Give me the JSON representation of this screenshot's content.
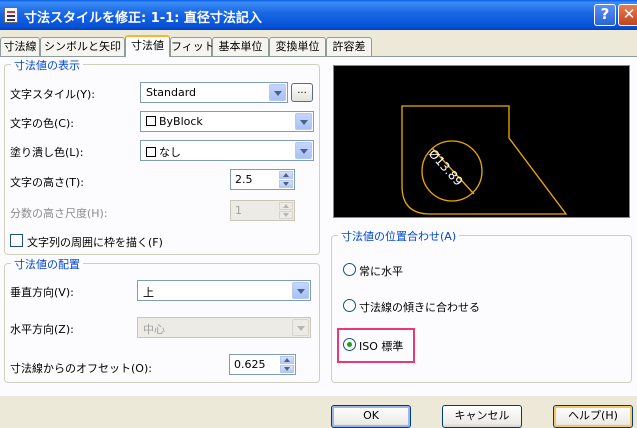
{
  "window": {
    "title": "寸法スタイルを修正: 1-1: 直径寸法記入",
    "help_glyph": "?",
    "close_glyph": "✕"
  },
  "tabs": [
    {
      "label": "寸法線"
    },
    {
      "label": "シンボルと矢印"
    },
    {
      "label": "寸法値",
      "active": true
    },
    {
      "label": "フィット"
    },
    {
      "label": "基本単位"
    },
    {
      "label": "変換単位"
    },
    {
      "label": "許容差"
    }
  ],
  "text_appearance": {
    "group_title": "寸法値の表示",
    "text_style_label": "文字スタイル(Y):",
    "text_style_value": "Standard",
    "ellipsis_label": "...",
    "text_color_label": "文字の色(C):",
    "text_color_value": "ByBlock",
    "fill_color_label": "塗り潰し色(L):",
    "fill_color_value": "なし",
    "text_height_label": "文字の高さ(T):",
    "text_height_value": "2.5",
    "fraction_scale_label": "分数の高さ尺度(H):",
    "fraction_scale_value": "1",
    "frame_label": "文字列の周囲に枠を描く(F)",
    "frame_checked": false
  },
  "text_placement": {
    "group_title": "寸法値の配置",
    "vertical_label": "垂直方向(V):",
    "vertical_value": "上",
    "horizontal_label": "水平方向(Z):",
    "horizontal_value": "中心",
    "offset_label": "寸法線からのオフセット(O):",
    "offset_value": "0.625"
  },
  "preview": {
    "dimension_text": "Ø13.89",
    "line_color": "#f2a900"
  },
  "text_alignment": {
    "group_title": "寸法値の位置合わせ(A)",
    "options": [
      {
        "label": "常に水平",
        "selected": false
      },
      {
        "label": "寸法線の傾きに合わせる",
        "selected": false
      },
      {
        "label": "ISO 標準",
        "selected": true
      }
    ]
  },
  "buttons": {
    "ok": "OK",
    "cancel": "キャンセル",
    "help": "ヘルプ(H)"
  },
  "colors": {
    "accent": "#0046d5",
    "highlight": "#e8387a",
    "radio_dot": "#21a121"
  }
}
